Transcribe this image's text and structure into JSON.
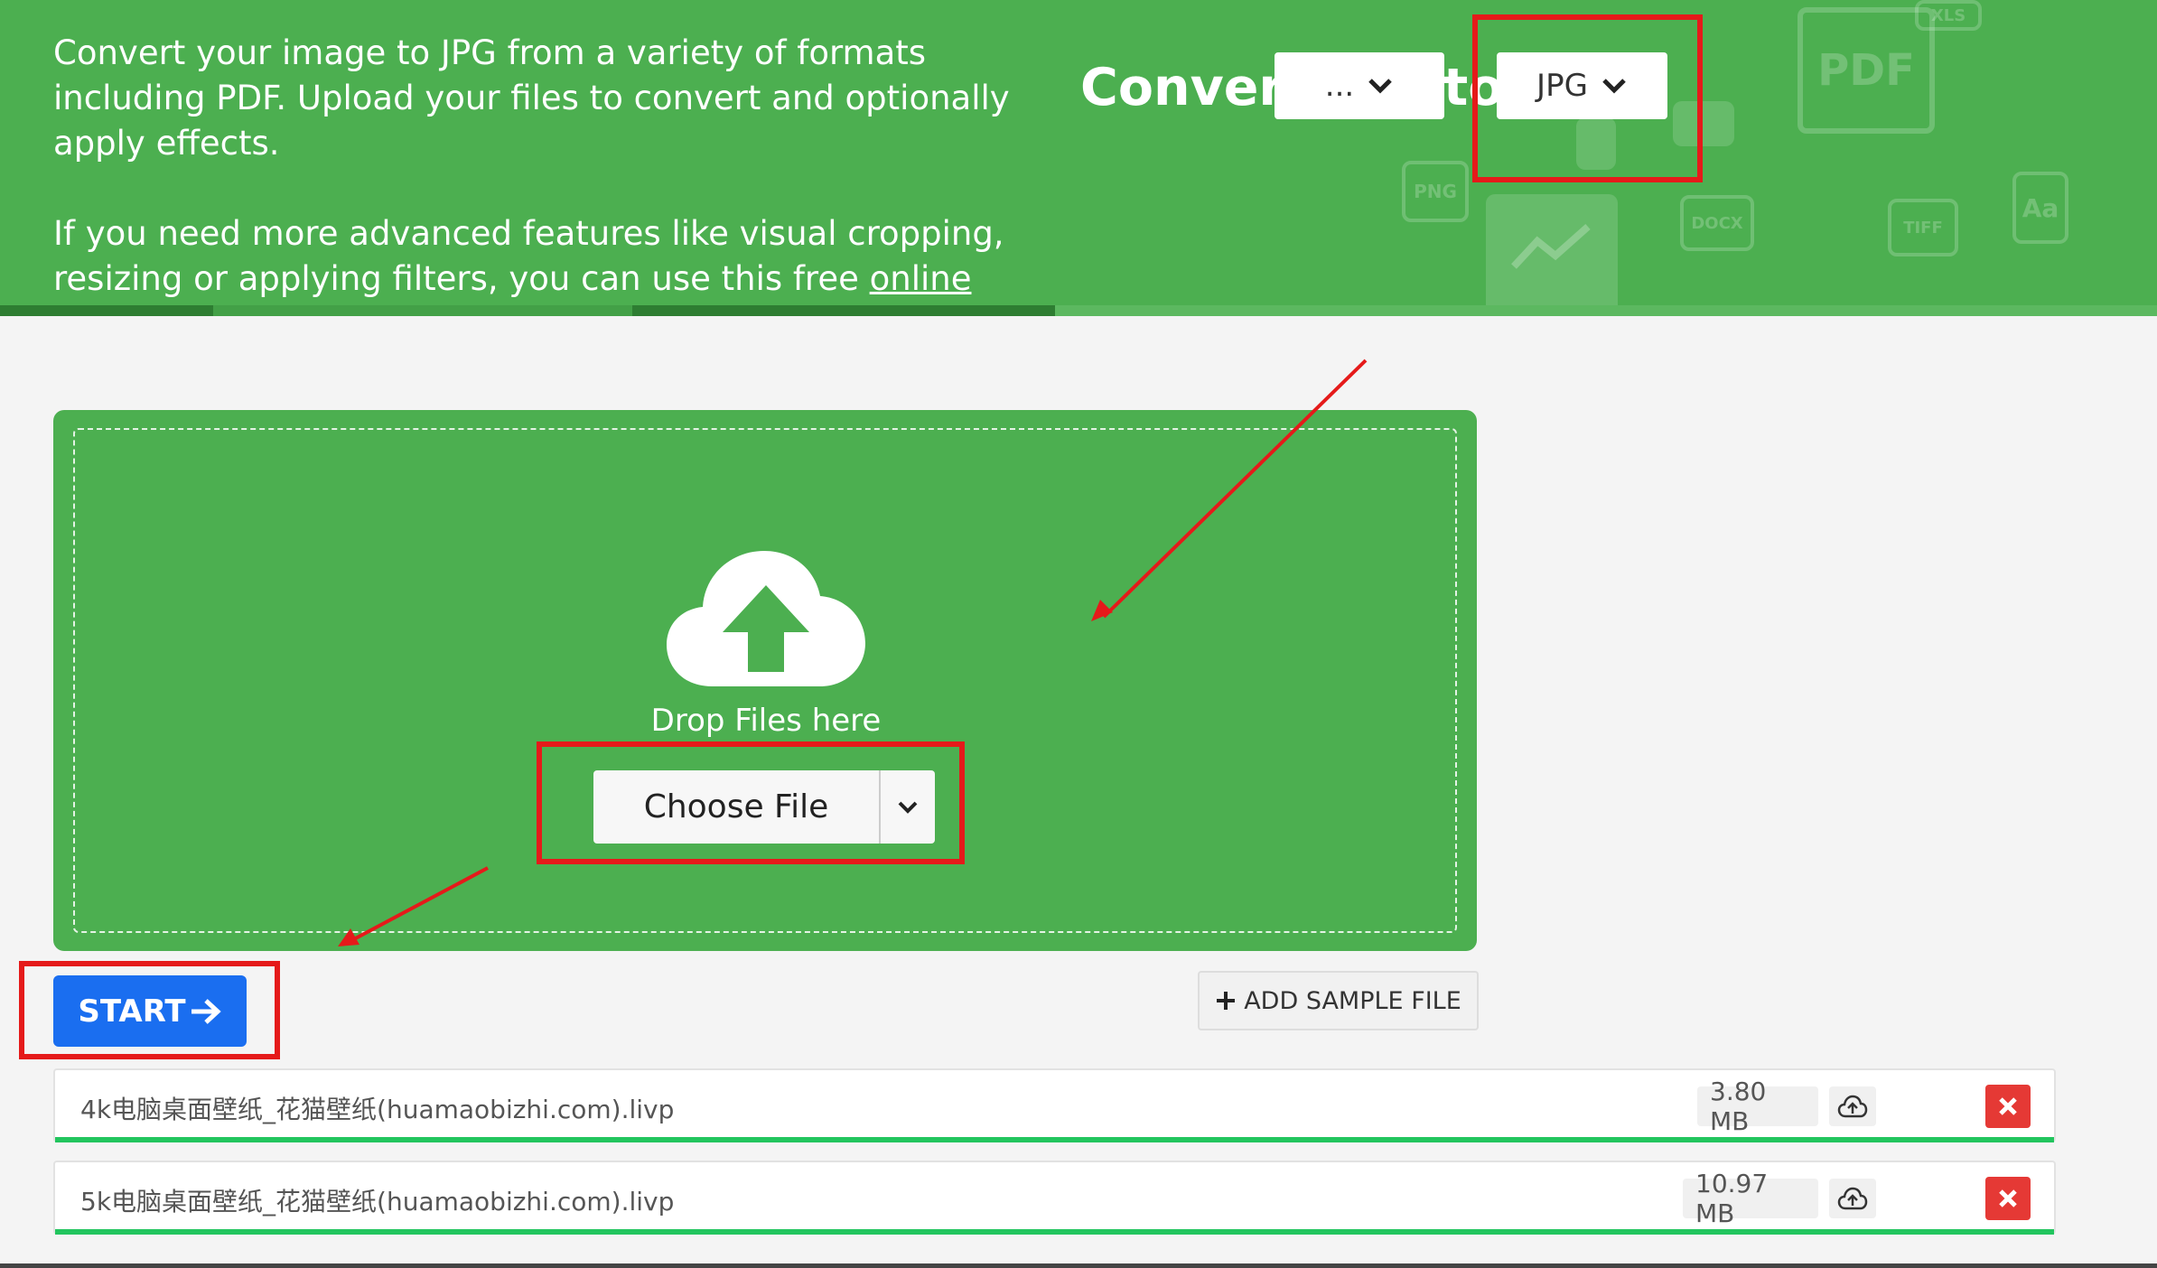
{
  "header": {
    "intro": "Convert your image to JPG from a variety of formats including PDF. Upload your files to convert and optionally apply effects.",
    "advanced_prefix": "If you need more advanced features like visual cropping, resizing or applying filters, you can use this free ",
    "advanced_link": "online image editor",
    "advanced_suffix": ".",
    "convert_label": "Convert",
    "to_label": "to",
    "from_select": "...",
    "to_select": "JPG",
    "background_format_icons": [
      "PDF",
      "PNG",
      "DOCX",
      "TIFF",
      "XLS",
      "Aa"
    ]
  },
  "dropzone": {
    "drop_text": "Drop Files here",
    "choose_file": "Choose File"
  },
  "actions": {
    "start": "START",
    "add_sample": "ADD SAMPLE FILE"
  },
  "files": [
    {
      "name": "4k电脑桌面壁纸_花猫壁纸(huamaobizhi.com).livp",
      "size": "3.80 MB",
      "progress": 1.0
    },
    {
      "name": "5k电脑桌面壁纸_花猫壁纸(huamaobizhi.com).livp",
      "size": "10.97 MB",
      "progress": 1.0
    }
  ],
  "colors": {
    "brand_green": "#4caf50",
    "start_blue": "#1a6ef0",
    "remove_red": "#e53935",
    "annotation_red": "#e51a1a",
    "progress_green": "#22c55e"
  }
}
